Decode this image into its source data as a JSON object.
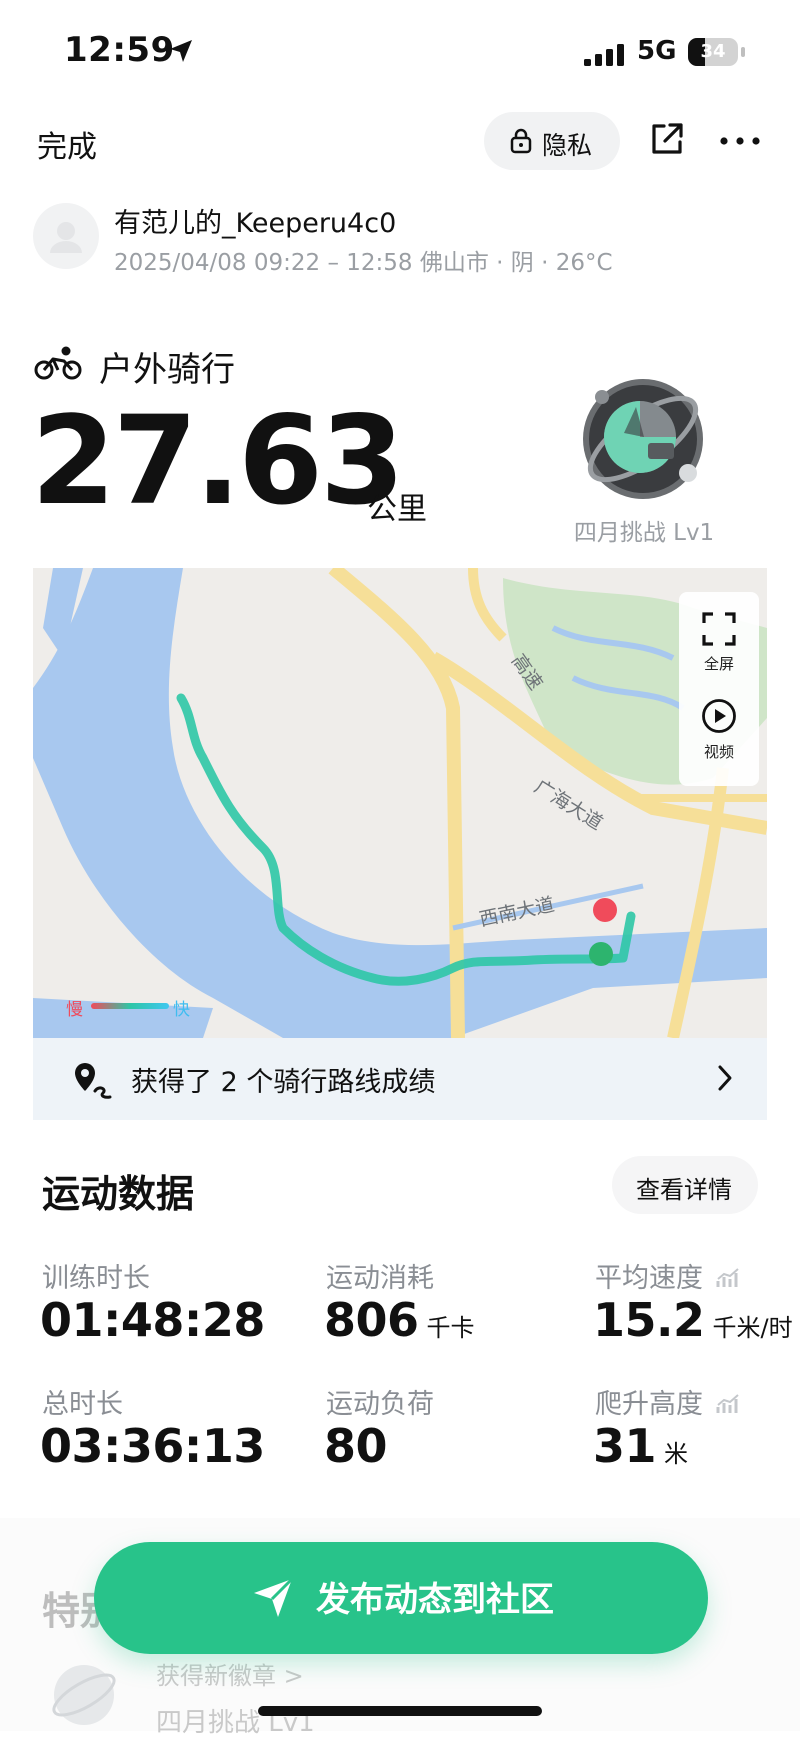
{
  "status_bar": {
    "time": "12:59",
    "network": "5G",
    "battery": "34",
    "battery_level": 0.34
  },
  "header": {
    "done_label": "完成",
    "privacy_label": "隐私",
    "share_icon": "share-icon",
    "more_icon": "more-icon"
  },
  "user": {
    "name": "有范儿的_Keeperu4c0",
    "meta": "2025/04/08 09:22 – 12:58 佛山市 · 阴 · 26°C"
  },
  "activity": {
    "type": "户外骑行",
    "distance": "27.63",
    "distance_unit": "公里",
    "badge_label": "四月挑战 Lv1"
  },
  "map": {
    "fullscreen_label": "全屏",
    "video_label": "视频",
    "legend_slow": "慢",
    "legend_fast": "快",
    "road_labels": [
      "高速",
      "广海大道",
      "西南大道"
    ],
    "colors": {
      "route": "#2ec6a6",
      "end": "#f04b5b",
      "start": "#2db46e",
      "water": "#a8c8ef",
      "road": "#f6df98",
      "park": "#cfe5c8"
    }
  },
  "routes": {
    "text": "获得了 2 个骑行路线成绩"
  },
  "stats": {
    "title": "运动数据",
    "details_label": "查看详情",
    "items": [
      {
        "label": "训练时长",
        "value": "01:48:28",
        "unit": ""
      },
      {
        "label": "运动消耗",
        "value": "806",
        "unit": "千卡"
      },
      {
        "label": "平均速度",
        "value": "15.2",
        "unit": "千米/时"
      },
      {
        "label": "总时长",
        "value": "03:36:13",
        "unit": ""
      },
      {
        "label": "运动负荷",
        "value": "80",
        "unit": ""
      },
      {
        "label": "爬升高度",
        "value": "31",
        "unit": "米"
      }
    ]
  },
  "features": {
    "title": "特别",
    "line1": "获得新徽章 >",
    "line2": "四月挑战 Lv1"
  },
  "publish": {
    "label": "发布动态到社区"
  },
  "theme": {
    "accent": "#28c38a"
  }
}
